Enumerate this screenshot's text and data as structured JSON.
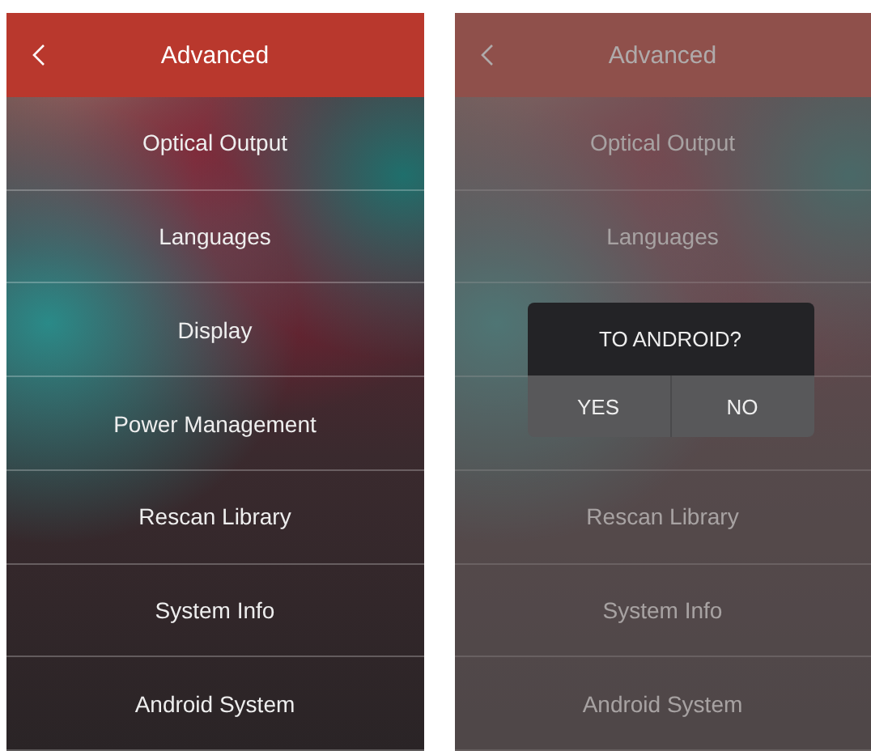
{
  "screens": [
    {
      "title": "Advanced",
      "dimmed": false,
      "items": [
        {
          "kind": "row",
          "label": "Optical Output"
        },
        {
          "kind": "row",
          "label": "Languages"
        },
        {
          "kind": "row",
          "label": "Display"
        },
        {
          "kind": "row",
          "label": "Power Management"
        },
        {
          "kind": "row",
          "label": "Rescan Library"
        },
        {
          "kind": "row",
          "label": "System Info"
        },
        {
          "kind": "row",
          "label": "Android System"
        }
      ]
    },
    {
      "title": "Advanced",
      "dimmed": true,
      "items": [
        {
          "kind": "row",
          "label": "Optical Output"
        },
        {
          "kind": "row",
          "label": "Languages"
        },
        {
          "kind": "covered"
        },
        {
          "kind": "covered"
        },
        {
          "kind": "row",
          "label": "Rescan Library"
        },
        {
          "kind": "row",
          "label": "System Info"
        },
        {
          "kind": "row",
          "label": "Android System"
        }
      ],
      "dialog": {
        "title": "TO ANDROID?",
        "buttons": [
          "YES",
          "NO"
        ]
      }
    }
  ]
}
